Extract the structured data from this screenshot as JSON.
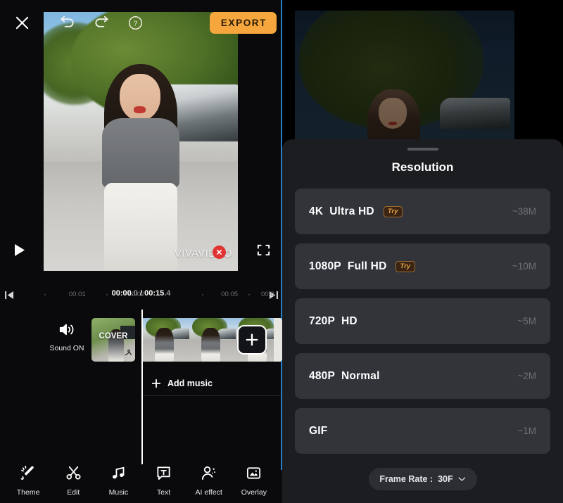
{
  "editor": {
    "topbar": {
      "close_icon": "close-icon",
      "undo_icon": "undo-icon",
      "redo_icon": "redo-icon",
      "help_icon": "help-icon",
      "export_label": "EXPORT",
      "export_color": "#f5a63c"
    },
    "preview": {
      "watermark": "VIVAVIDEO",
      "watermark_close_icon": "close-badge-icon",
      "play_icon": "play-icon",
      "fullscreen_icon": "fullscreen-icon"
    },
    "timeline": {
      "jump_start_icon": "skip-to-start-icon",
      "jump_end_icon": "skip-to-end-icon",
      "ticks": [
        "00:01",
        "00:02",
        "00:05",
        "00:0"
      ],
      "current_time": "00:00",
      "current_time_frac": ".0",
      "separator": " / ",
      "total_time": "00:15",
      "total_time_frac": ".4"
    },
    "tracks": {
      "sound_icon": "speaker-on-icon",
      "sound_label": "Sound ON",
      "cover_label": "COVER",
      "cover_edit_icon": "pen-icon",
      "add_clip_icon": "plus-icon",
      "add_music_icon": "plus-icon",
      "add_music_label": "Add music"
    },
    "toolbar": [
      {
        "label": "Theme",
        "icon": "magic-wand-icon"
      },
      {
        "label": "Edit",
        "icon": "scissors-icon"
      },
      {
        "label": "Music",
        "icon": "music-note-icon"
      },
      {
        "label": "Text",
        "icon": "text-box-icon"
      },
      {
        "label": "AI effect",
        "icon": "person-sparkle-icon"
      },
      {
        "label": "Overlay",
        "icon": "image-frame-icon"
      }
    ]
  },
  "panel": {
    "grabber_icon": "drag-handle-icon",
    "title": "Resolution",
    "options": [
      {
        "main": "4K",
        "sub": "Ultra HD",
        "badge": "Try",
        "size": "~38M"
      },
      {
        "main": "1080P",
        "sub": "Full HD",
        "badge": "Try",
        "size": "~10M"
      },
      {
        "main": "720P",
        "sub": "HD",
        "badge": "",
        "size": "~5M"
      },
      {
        "main": "480P",
        "sub": "Normal",
        "badge": "",
        "size": "~2M"
      },
      {
        "main": "GIF",
        "sub": "",
        "badge": "",
        "size": "~1M"
      }
    ],
    "frame_rate_label": "Frame Rate :",
    "frame_rate_value": "30F",
    "frame_rate_icon": "chevron-down-icon"
  }
}
